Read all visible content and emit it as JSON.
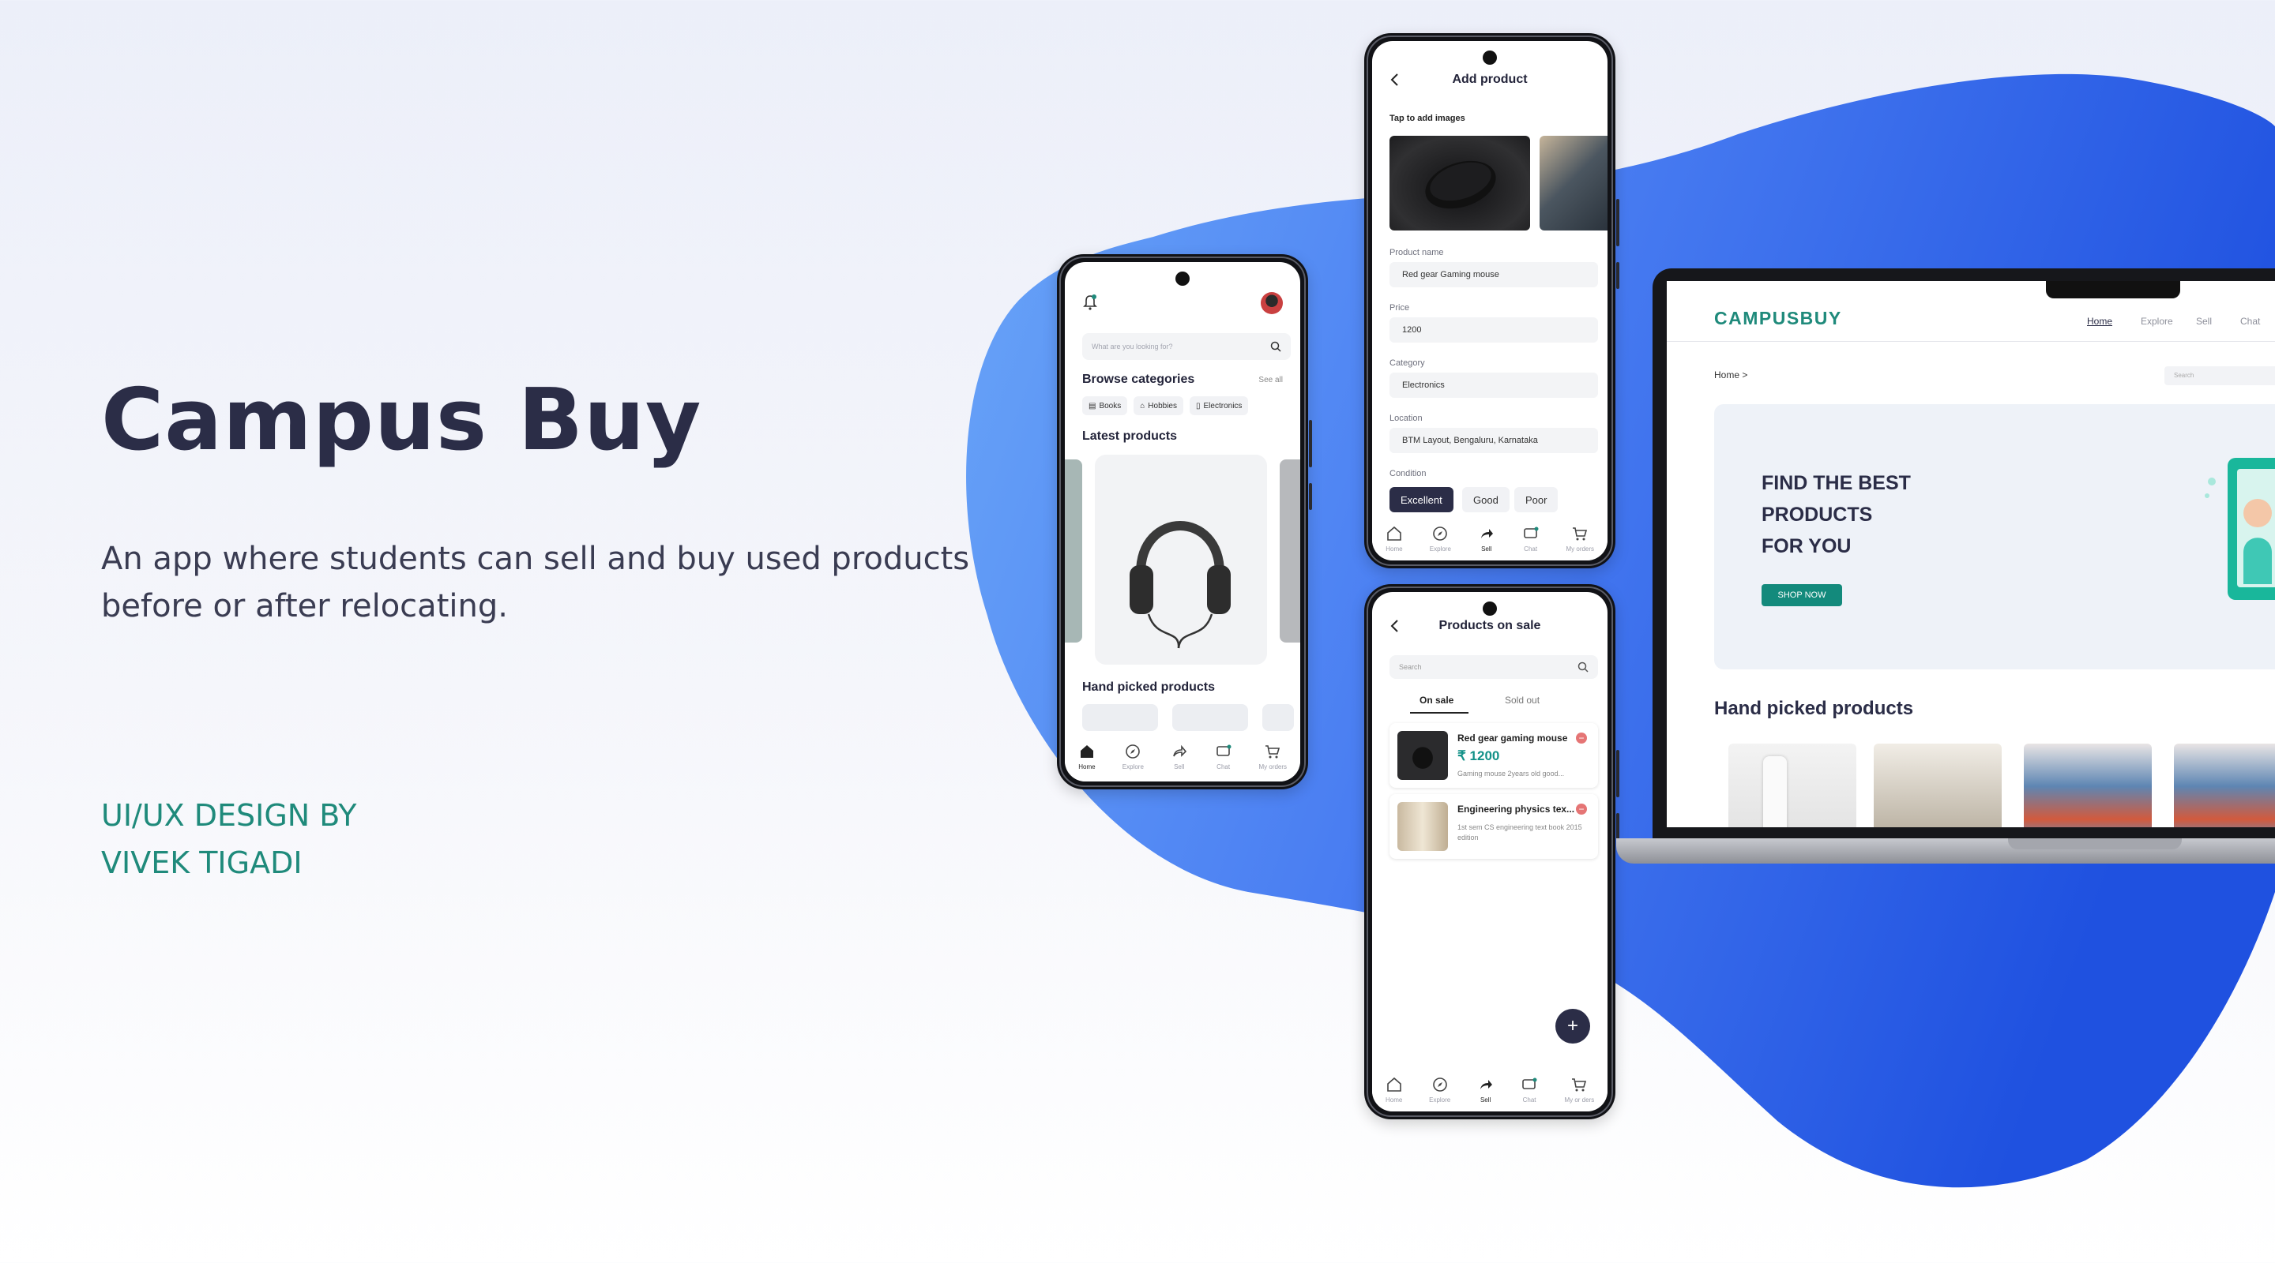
{
  "hero": {
    "title": "Campus Buy",
    "description": "An app where students can sell and buy used products before or after relocating.",
    "credit_line1": "UI/UX DESIGN BY",
    "credit_line2": "VIVEK TIGADI"
  },
  "colors": {
    "accent": "#1f8a7b",
    "blob": "#3f6ff0",
    "dark": "#2b2d47"
  },
  "home_screen": {
    "search_placeholder": "What are you looking for?",
    "browse_title": "Browse categories",
    "see_all": "See all",
    "categories": [
      "Books",
      "Hobbies",
      "Electronics"
    ],
    "latest_title": "Latest products",
    "handpicked_title": "Hand picked products",
    "tabs": [
      "Home",
      "Explore",
      "Sell",
      "Chat",
      "My orders"
    ]
  },
  "add_product": {
    "title": "Add product",
    "tap_images": "Tap to add images",
    "product_name_label": "Product name",
    "product_name_value": "Red gear Gaming mouse",
    "price_label": "Price",
    "price_value": "1200",
    "category_label": "Category",
    "category_value": "Electronics",
    "location_label": "Location",
    "location_value": "BTM Layout, Bengaluru, Karnataka",
    "condition_label": "Condition",
    "conditions": [
      "Excellent",
      "Good",
      "Poor"
    ],
    "tabs": [
      "Home",
      "Explore",
      "Sell",
      "Chat",
      "My orders"
    ]
  },
  "products_on_sale": {
    "title": "Products on sale",
    "search_placeholder": "Search",
    "tab_on_sale": "On sale",
    "tab_sold_out": "Sold out",
    "items": [
      {
        "name": "Red gear gaming mouse",
        "price": "₹ 1200",
        "desc": "Gaming mouse 2years old good..."
      },
      {
        "name": "Engineering physics tex...",
        "desc": "1st sem CS engineering  text book 2015 edition"
      }
    ],
    "fab": "+",
    "tabs": [
      "Home",
      "Explore",
      "Sell",
      "Chat",
      "My or ders"
    ]
  },
  "website": {
    "logo": "CAMPUSBUY",
    "nav": [
      "Home",
      "Explore",
      "Sell",
      "Chat"
    ],
    "breadcrumb": "Home >",
    "search_placeholder": "Search",
    "banner_line1": "FIND THE BEST",
    "banner_line2": "PRODUCTS",
    "banner_line3": "FOR YOU",
    "shop_now": "SHOP NOW",
    "handpicked_title": "Hand picked products"
  }
}
